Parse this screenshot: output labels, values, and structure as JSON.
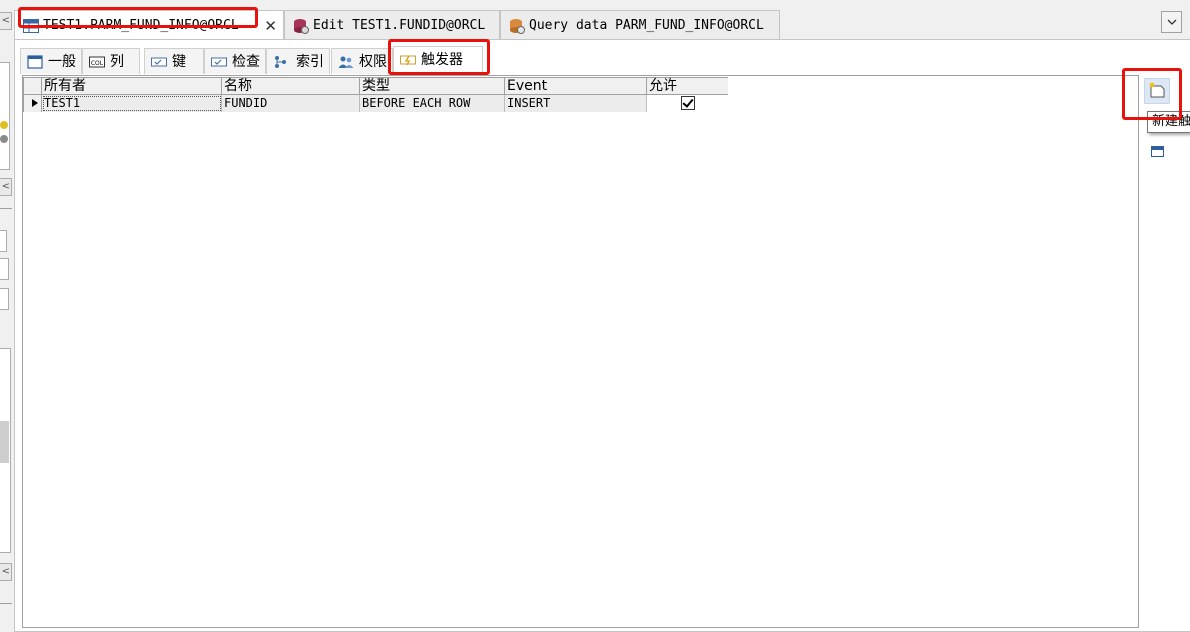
{
  "document_tabs": [
    {
      "label": "TEST1.PARM_FUND_INFO@ORCL",
      "active": true,
      "icon": "table-icon",
      "close": "✕"
    },
    {
      "label": "Edit TEST1.FUNDID@ORCL",
      "active": false,
      "icon": "sequence-edit-icon"
    },
    {
      "label": "Query data PARM_FUND_INFO@ORCL",
      "active": false,
      "icon": "query-data-icon"
    }
  ],
  "sub_tabs": [
    {
      "label": "一般",
      "icon": "general-icon"
    },
    {
      "label": "列",
      "icon": "columns-icon"
    },
    {
      "label": "键",
      "icon": "keys-icon"
    },
    {
      "label": "检查",
      "icon": "checks-icon"
    },
    {
      "label": "索引",
      "icon": "indexes-icon"
    },
    {
      "label": "权限",
      "icon": "privileges-icon"
    },
    {
      "label": "触发器",
      "icon": "triggers-icon",
      "active": true
    }
  ],
  "grid": {
    "columns": [
      "所有者",
      "名称",
      "类型",
      "Event",
      "允许"
    ],
    "rows": [
      {
        "owner": "TEST1",
        "name": "FUNDID",
        "type": "BEFORE EACH ROW",
        "event": "INSERT",
        "enabled": true
      }
    ]
  },
  "toolbar": {
    "new_trigger_icon": "new-trigger-icon",
    "second_icon": "window-icon",
    "tooltip": "新建触"
  },
  "colors": {
    "highlight": "#e8120c",
    "background": "#f0f0f0",
    "panel": "#ffffff"
  }
}
